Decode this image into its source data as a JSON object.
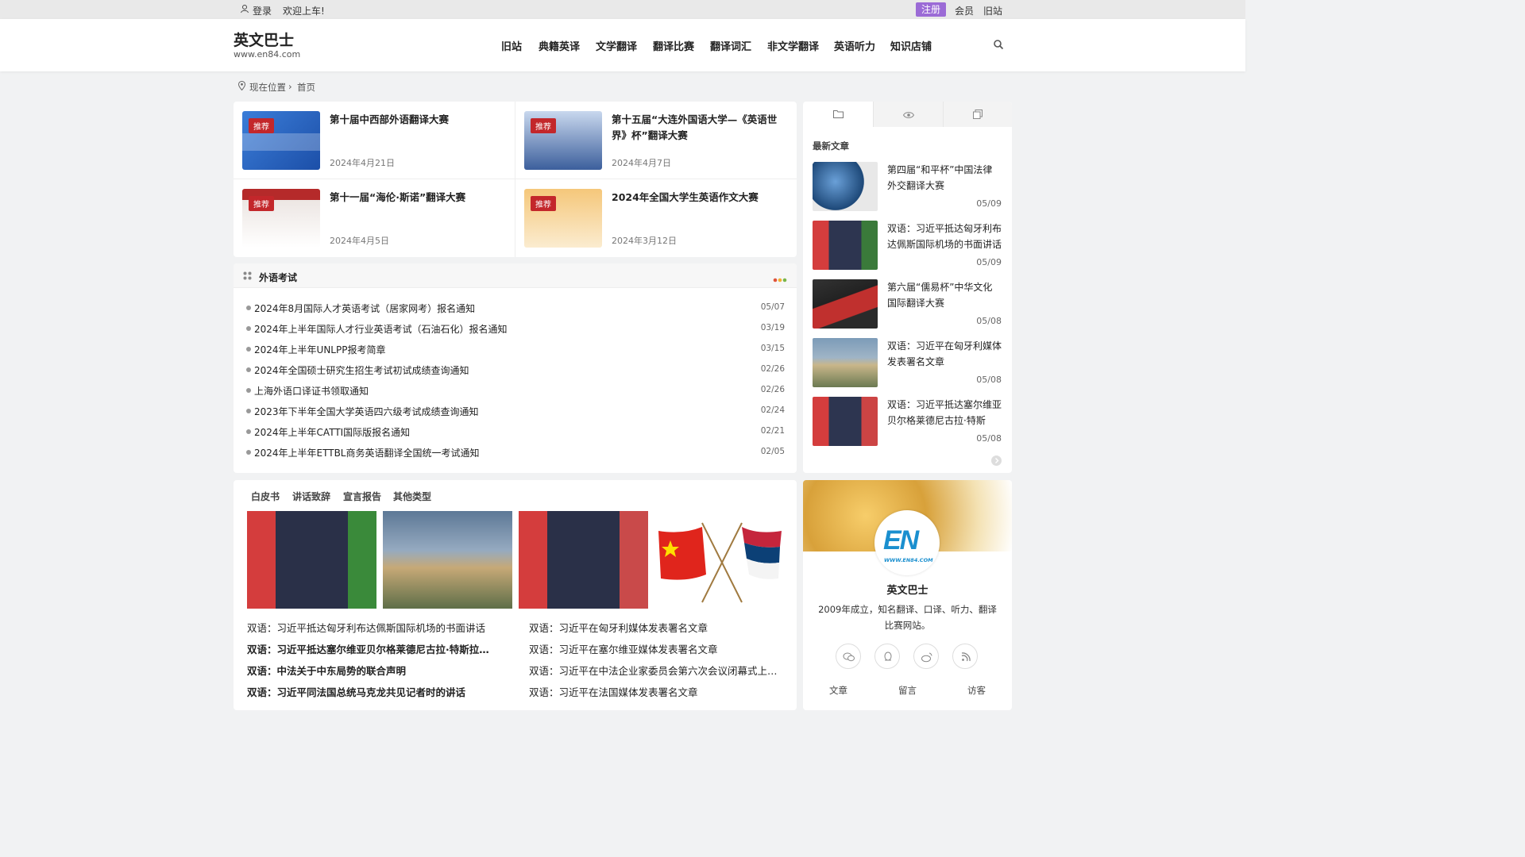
{
  "topbar": {
    "login": "登录",
    "welcome": "欢迎上车!",
    "register": "注册",
    "member": "会员",
    "old_site": "旧站"
  },
  "header": {
    "site_name": "英文巴士",
    "site_url": "www.en84.com",
    "nav": [
      "旧站",
      "典籍英译",
      "文学翻译",
      "翻译比赛",
      "翻译词汇",
      "非文学翻译",
      "英语听力",
      "知识店铺"
    ]
  },
  "breadcrumb": {
    "label": "现在位置",
    "home": "首页"
  },
  "featured": [
    {
      "badge": "推荐",
      "title": "第十届中西部外语翻译大赛",
      "date": "2024年4月21日"
    },
    {
      "badge": "推荐",
      "title": "第十五届“大连外国语大学—《英语世界》杯”翻译大赛",
      "date": "2024年4月7日"
    },
    {
      "badge": "推荐",
      "title": "第十一届“海伦·斯诺”翻译大赛",
      "date": "2024年4月5日"
    },
    {
      "badge": "推荐",
      "title": "2024年全国大学生英语作文大赛",
      "date": "2024年3月12日"
    }
  ],
  "exam_section": {
    "title": "外语考试",
    "items": [
      {
        "title": "2024年8月国际人才英语考试（居家网考）报名通知",
        "date": "05/07"
      },
      {
        "title": "2024年上半年国际人才行业英语考试（石油石化）报名通知",
        "date": "03/19"
      },
      {
        "title": "2024年上半年UNLPP报考简章",
        "date": "03/15"
      },
      {
        "title": "2024年全国硕士研究生招生考试初试成绩查询通知",
        "date": "02/26"
      },
      {
        "title": "上海外语口译证书领取通知",
        "date": "02/26"
      },
      {
        "title": "2023年下半年全国大学英语四六级考试成绩查询通知",
        "date": "02/24"
      },
      {
        "title": "2024年上半年CATTI国际版报名通知",
        "date": "02/21"
      },
      {
        "title": "2024年上半年ETTBL商务英语翻译全国统一考试通知",
        "date": "02/05"
      }
    ]
  },
  "sidebar": {
    "section_title": "最新文章",
    "items": [
      {
        "title": "第四届“和平杯”中国法律外交翻译大赛",
        "date": "05/09"
      },
      {
        "title": "双语：习近平抵达匈牙利布达佩斯国际机场的书面讲话",
        "date": "05/09"
      },
      {
        "title": "第六届“儒易杯”中华文化国际翻译大赛",
        "date": "05/08"
      },
      {
        "title": "双语：习近平在匈牙利媒体发表署名文章",
        "date": "05/08"
      },
      {
        "title": "双语：习近平抵达塞尔维亚贝尔格莱德尼古拉·特斯拉...",
        "date": "05/08"
      }
    ]
  },
  "docs_section": {
    "tabs": [
      "白皮书",
      "讲话致辞",
      "宣言报告",
      "其他类型"
    ],
    "left_links": [
      "双语：习近平抵达匈牙利布达佩斯国际机场的书面讲话",
      "双语：习近平抵达塞尔维亚贝尔格莱德尼古拉·特斯拉国...",
      "双语：中法关于中东局势的联合声明",
      "双语：习近平同法国总统马克龙共见记者时的讲话"
    ],
    "right_links": [
      "双语：习近平在匈牙利媒体发表署名文章",
      "双语：习近平在塞尔维亚媒体发表署名文章",
      "双语：习近平在中法企业家委员会第六次会议闭幕式上的...",
      "双语：习近平在法国媒体发表署名文章"
    ]
  },
  "profile": {
    "logo_text": "EN",
    "logo_url": "WWW.EN84.COM",
    "name": "英文巴士",
    "desc": "2009年成立，知名翻译、口译、听力、翻译比赛网站。",
    "stats": [
      "文章",
      "留言",
      "访客"
    ]
  },
  "colors": {
    "accent": "#c3272b",
    "register_bg": "#9b6bd6"
  }
}
